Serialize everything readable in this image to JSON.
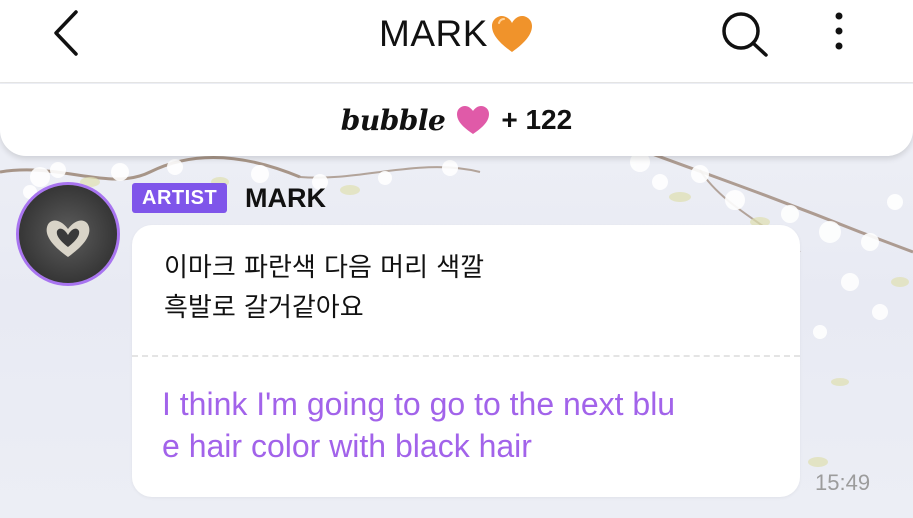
{
  "header": {
    "title": "MARK",
    "title_heart": "orange-heart-icon",
    "back_icon": "chevron-left-icon",
    "search_icon": "search-icon",
    "more_icon": "more-vertical-icon"
  },
  "bubble_bar": {
    "brand": "bubble",
    "heart": "pink-heart-icon",
    "count": "+ 122"
  },
  "chat": {
    "message": {
      "badge": "ARTIST",
      "sender": "MARK",
      "original_text": "이마크 파란색 다음 머리 색깔\n흑발로 갈거같아요",
      "translation": "I think I'm going to go to the next blu\ne hair color with black hair",
      "time": "15:49"
    }
  },
  "colors": {
    "accent_purple": "#7f55ea",
    "translation_purple": "#a263ea",
    "heart_orange": "#f0932b",
    "heart_pink": "#e05aa8"
  }
}
